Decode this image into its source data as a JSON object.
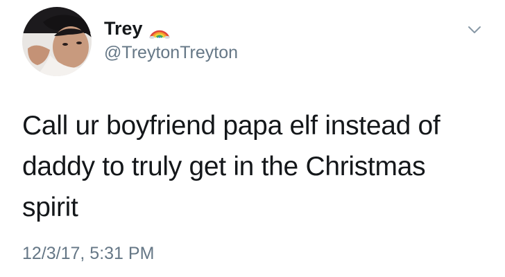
{
  "tweet": {
    "author": {
      "display_name": "Trey",
      "handle": "@TreytonTreyton",
      "badge_icon": "rainbow-icon",
      "avatar_icon": "avatar"
    },
    "text": "Call ur boyfriend papa elf instead of daddy to truly get in the Christmas spirit",
    "timestamp": "12/3/17, 5:31 PM",
    "menu_icon": "chevron-down-icon"
  },
  "colors": {
    "primary_text": "#14171a",
    "secondary_text": "#657786",
    "background": "#ffffff"
  }
}
